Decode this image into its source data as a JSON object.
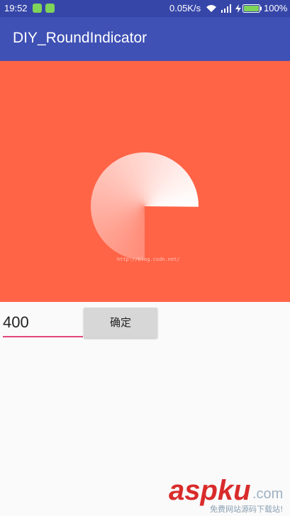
{
  "status_bar": {
    "time": "19:52",
    "network_speed": "0.05K/s",
    "battery": "100%"
  },
  "app_bar": {
    "title": "DIY_RoundIndicator"
  },
  "indicator": {
    "value": 400,
    "max": 360,
    "colors": {
      "background": "#ff6447",
      "sweep_start": "#ff8c78",
      "sweep_end": "#ffffff"
    }
  },
  "watermark_url": "http://blog.csdn.net/",
  "input": {
    "value": "400"
  },
  "confirm_button": {
    "label": "确定"
  },
  "logo": {
    "brand_main": "aspku",
    "brand_suffix": ".com",
    "slogan": "免费网站源码下载站!"
  }
}
